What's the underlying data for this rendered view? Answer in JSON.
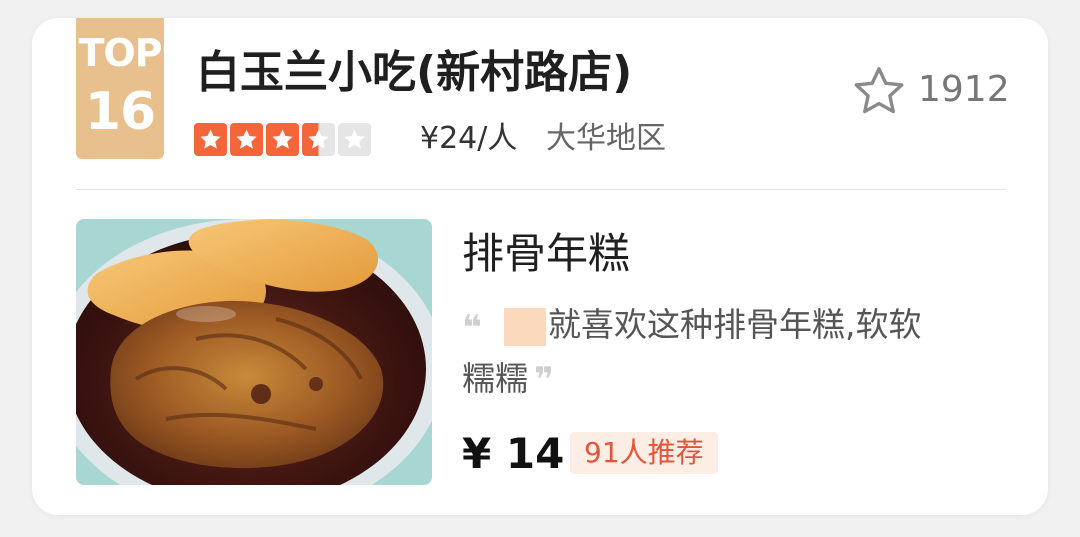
{
  "rank": {
    "label": "TOP",
    "number": "16",
    "color": "#e7c08d"
  },
  "shop": {
    "name": "白玉兰小吃(新村路店)",
    "rating_stars": 3.5,
    "rating_max": 5,
    "star_color": "#f2663a",
    "price_per_person": "¥24/人",
    "area": "大华地区",
    "favorite_icon": "star-outline-icon",
    "favorite_count": "1912"
  },
  "dish": {
    "name": "排骨年糕",
    "quote_open": "❝",
    "review_line1": "就喜欢这种排骨年糕,软软",
    "review_line2": "糯糯",
    "quote_close": "❞",
    "price": "¥ 14",
    "recommend": "91人推荐",
    "recommend_color": "#e4553a"
  }
}
